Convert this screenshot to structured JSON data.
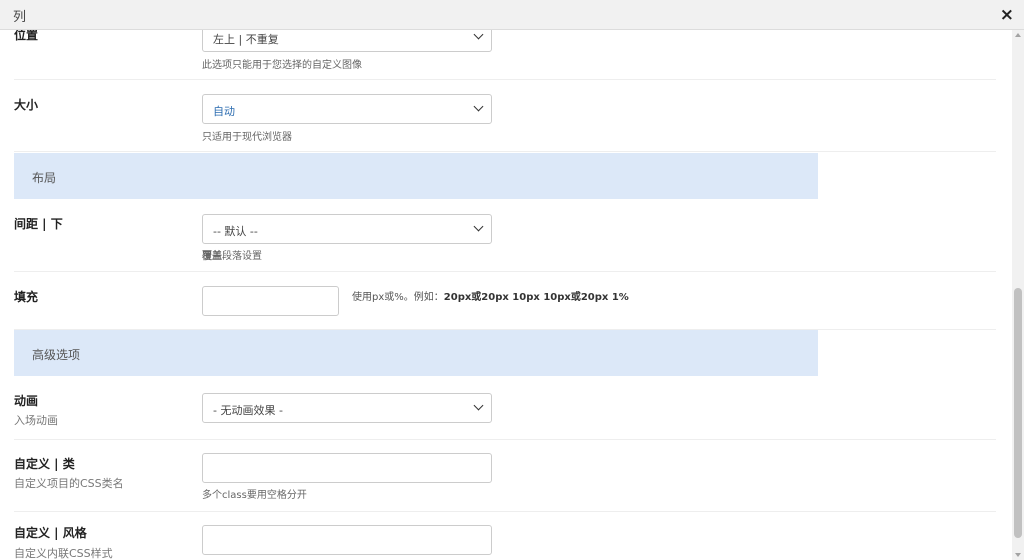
{
  "dialog": {
    "title": "列",
    "close_icon": "×"
  },
  "rows": {
    "position": {
      "label": "位置",
      "select_value": "左上 | 不重复",
      "hint": "此选项只能用于您选择的自定义图像"
    },
    "size": {
      "label": "大小",
      "select_value": "自动",
      "hint": "只适用于现代浏览器"
    },
    "spacing_bottom": {
      "label": "间距 | 下",
      "select_value": "-- 默认 --",
      "hint_bold": "覆盖",
      "hint": "段落设置"
    },
    "padding": {
      "label": "填充",
      "input_value": "",
      "hint_prefix": "使用px或%。例如：",
      "hint_example": "20px或20px 10px 10px或20px 1%"
    },
    "animation": {
      "label": "动画",
      "sublabel": "入场动画",
      "select_value": "- 无动画效果 -"
    },
    "custom_class": {
      "label": "自定义 | 类",
      "sublabel": "自定义项目的CSS类名",
      "input_value": "",
      "hint": "多个class要用空格分开"
    },
    "custom_style": {
      "label": "自定义 | 风格",
      "sublabel": "自定义内联CSS样式",
      "input_value": ""
    }
  },
  "sections": {
    "layout": "布局",
    "advanced": "高级选项"
  },
  "colors": {
    "section_bg": "#dce8f8",
    "accent_text": "#2b6cb0"
  }
}
